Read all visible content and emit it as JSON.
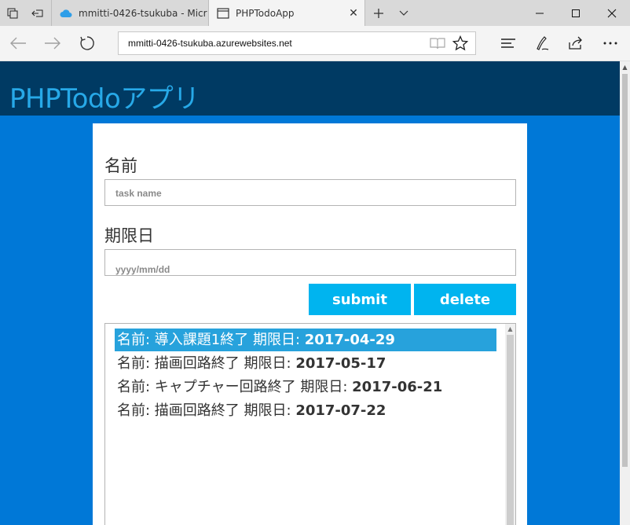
{
  "browser": {
    "tabs": [
      {
        "title": "mmitti-0426-tsukuba - Micr",
        "icon": "cloud-icon"
      },
      {
        "title": "PHPTodoApp",
        "icon": "page-icon"
      }
    ],
    "url": "mmitti-0426-tsukuba.azurewebsites.net",
    "new_tab_glyph": "+",
    "close_glyph": "✕"
  },
  "app": {
    "title": "PHPTodoアプリ",
    "form": {
      "name_label": "名前",
      "name_placeholder": "task name",
      "date_label": "期限日",
      "date_placeholder": "yyyy/mm/dd"
    },
    "buttons": {
      "submit": "submit",
      "delete": "delete"
    },
    "tasks": [
      {
        "name_prefix": "名前: ",
        "name": "導入課題1終了",
        "date_label": " 期限日: ",
        "date": "2017-04-29",
        "selected": true
      },
      {
        "name_prefix": "名前: ",
        "name": "描画回路終了",
        "date_label": " 期限日: ",
        "date": "2017-05-17",
        "selected": false
      },
      {
        "name_prefix": "名前: ",
        "name": "キャプチャー回路終了",
        "date_label": " 期限日: ",
        "date": "2017-06-21",
        "selected": false
      },
      {
        "name_prefix": "名前: ",
        "name": "描画回路終了",
        "date_label": " 期限日: ",
        "date": "2017-07-22",
        "selected": false
      }
    ]
  },
  "colors": {
    "page_bg": "#0078d7",
    "header_bg": "#003a63",
    "title": "#27a9e8",
    "button": "#00b4ef",
    "selection": "#27a2dc"
  }
}
